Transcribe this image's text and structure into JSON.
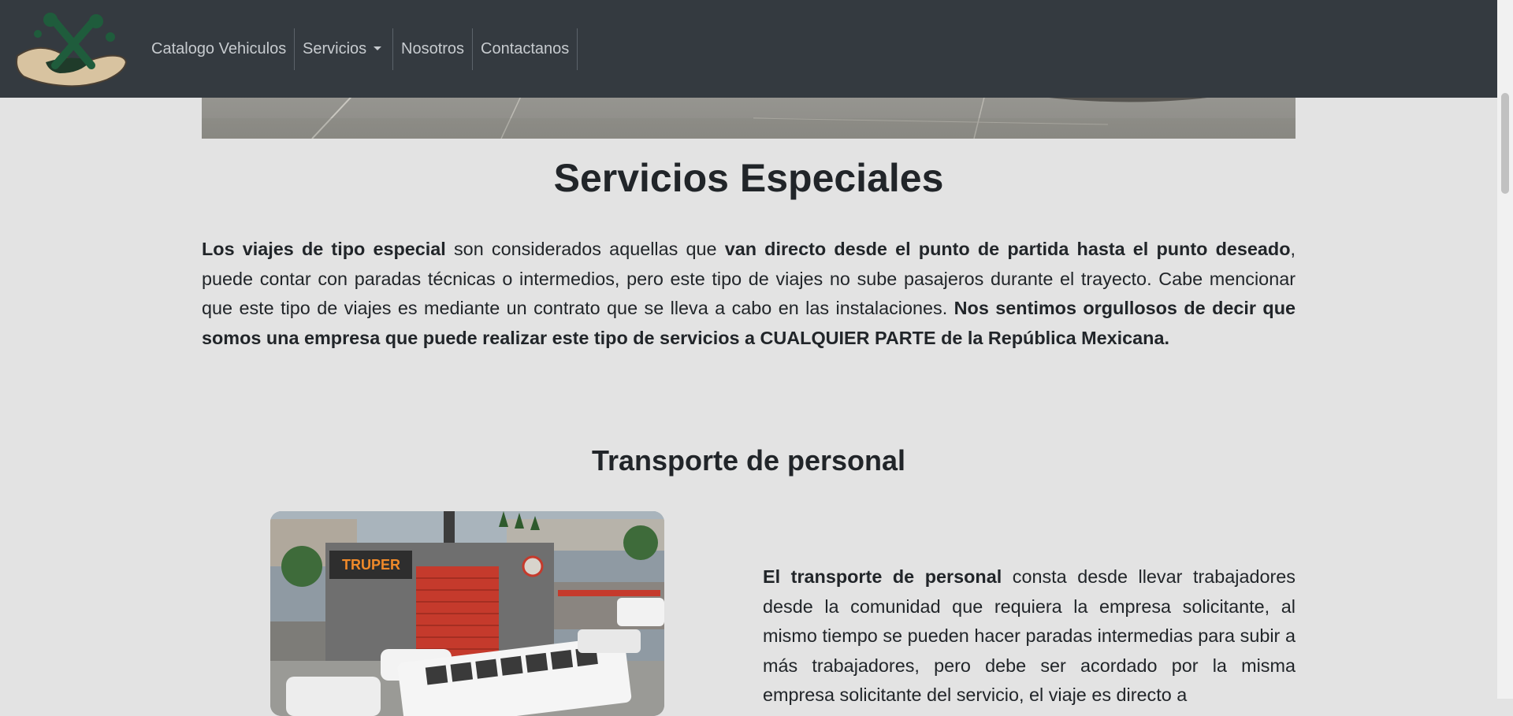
{
  "nav": {
    "items": [
      {
        "label": "Catalogo Vehiculos"
      },
      {
        "label": "Servicios"
      },
      {
        "label": "Nosotros"
      },
      {
        "label": "Contactanos"
      }
    ]
  },
  "page": {
    "title": "Servicios Especiales",
    "intro": [
      {
        "text": "Los viajes de tipo especial",
        "bold": true
      },
      {
        "text": " son considerados aquellas que ",
        "bold": false
      },
      {
        "text": "van directo desde el punto de partida hasta el punto deseado",
        "bold": true
      },
      {
        "text": ", puede contar con paradas técnicas o intermedios, pero este tipo de viajes no sube pasajeros durante el trayecto. Cabe mencionar que este tipo de viajes es mediante un contrato que se lleva a cabo en las instalaciones. ",
        "bold": false
      },
      {
        "text": "Nos sentimos orgullosos de decir que somos una empresa que puede realizar este tipo de servicios a CUALQUIER PARTE de la República Mexicana.",
        "bold": true
      }
    ]
  },
  "section": {
    "title": "Transporte de personal",
    "photo_sign": "TRUPER",
    "desc": [
      {
        "text": "El transporte de personal",
        "bold": true
      },
      {
        "text": " consta desde llevar trabajadores desde la comunidad que requiera la empresa solicitante, al mismo tiempo se pueden hacer paradas intermedias para subir a más trabajadores, pero debe ser acordado por la misma empresa solicitante del servicio, el viaje es directo a",
        "bold": false
      }
    ]
  }
}
